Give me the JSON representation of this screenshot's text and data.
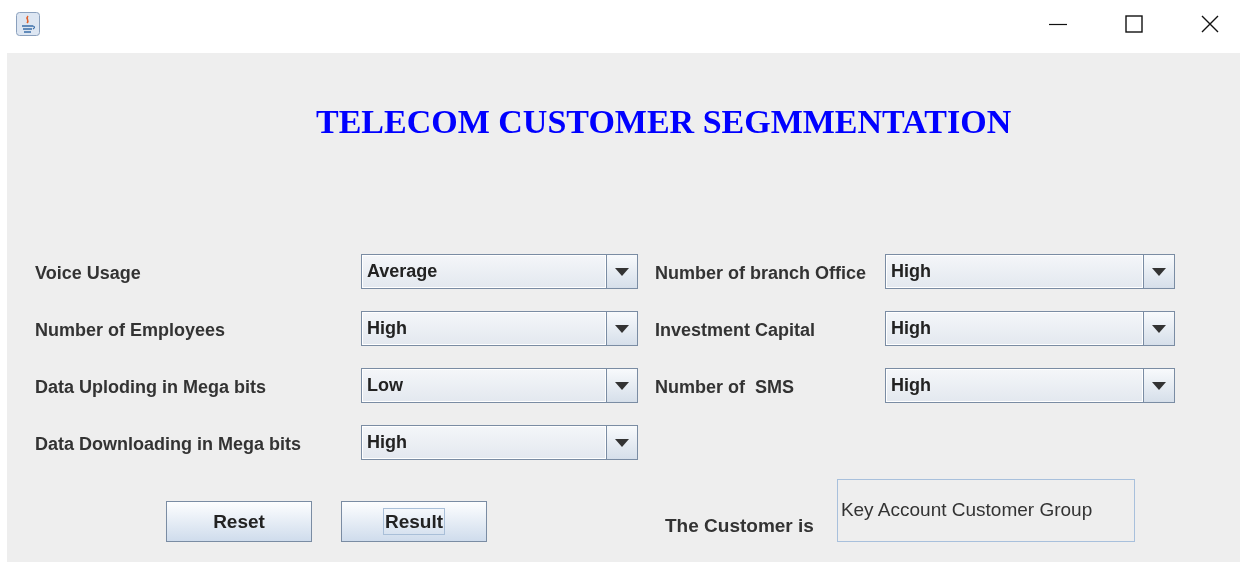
{
  "title": "TELECOM CUSTOMER SEGMMENTATION",
  "rows": [
    {
      "fields": [
        {
          "label": "Voice Usage",
          "value": "Average"
        },
        {
          "label": "Number of branch Office",
          "value": "High"
        }
      ]
    },
    {
      "fields": [
        {
          "label": "Number of Employees",
          "value": "High"
        },
        {
          "label": "Investment Capital",
          "value": "High"
        }
      ]
    },
    {
      "fields": [
        {
          "label": "Data Uploding in Mega bits",
          "value": "Low"
        },
        {
          "label": "Number of  SMS",
          "value": "High"
        }
      ]
    },
    {
      "fields": [
        {
          "label": "Data Downloading in Mega bits",
          "value": "High"
        }
      ]
    }
  ],
  "buttons": [
    {
      "label": "Reset",
      "focused": false
    },
    {
      "label": "Result",
      "focused": true
    }
  ],
  "result": {
    "label": "The Customer is",
    "value": "Key Account Customer Group"
  }
}
